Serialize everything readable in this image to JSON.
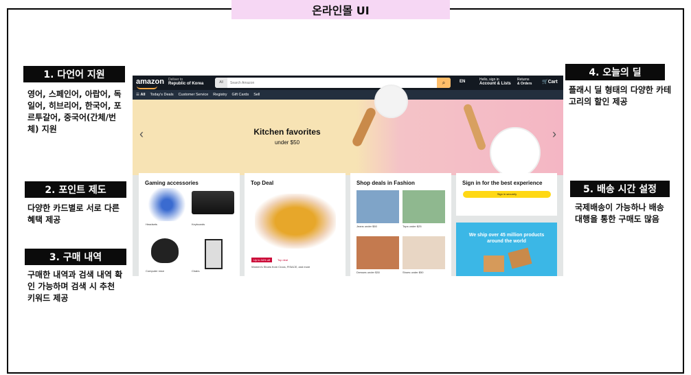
{
  "page_title": "온라인몰 UI",
  "labels": [
    {
      "title": "1. 다언어 지원",
      "desc": "영어, 스페인어, 아랍어, 독일어, 히브리어, 한국어, 포르투갈어, 중국어(간체/번체) 지원"
    },
    {
      "title": "2. 포인트 제도",
      "desc": "다양한 카드별로 서로 다른 혜택 제공"
    },
    {
      "title": "3. 구매 내역",
      "desc": "구매한 내역과 검색 내역 확인 가능하며 검색 시 추천 키워드 제공"
    },
    {
      "title": "4. 오늘의 딜",
      "desc": "플래시 딜 형태의 다양한 카테고리의 할인 제공"
    },
    {
      "title": "5. 배송 시간 설정",
      "desc": "국제배송이 가능하나 배송 대행을 통한 구매도 많음"
    }
  ],
  "amazon": {
    "logo": "amazon",
    "deliver_to": "Deliver to",
    "deliver_loc": "Republic of Korea",
    "search_cat": "All",
    "search_placeholder": "Search Amazon",
    "lang": "EN",
    "account_top": "Hello, sign in",
    "account": "Account & Lists",
    "returns_top": "Returns",
    "returns": "& Orders",
    "cart": "Cart",
    "nav": [
      "All",
      "Today's Deals",
      "Customer Service",
      "Registry",
      "Gift Cards",
      "Sell"
    ],
    "hero_title": "Kitchen favorites",
    "hero_sub": "under $50",
    "cards": {
      "gaming": {
        "title": "Gaming accessories",
        "items": [
          "Headsets",
          "Keyboards",
          "Computer mice",
          "Chairs"
        ]
      },
      "deal": {
        "title": "Top Deal",
        "badge": "Up to 34% off",
        "badge2": "Top deal",
        "desc": "Women's Shoes from Crocs, FISACE, and more"
      },
      "fashion": {
        "title": "Shop deals in Fashion",
        "items": [
          "Jeans under $50",
          "Tops under $25",
          "Dresses under $30",
          "Shoes under $50"
        ]
      },
      "signin": {
        "title": "Sign in for the best experience",
        "btn": "Sign in securely",
        "ship": "We ship over 45 million products around the world"
      }
    }
  }
}
